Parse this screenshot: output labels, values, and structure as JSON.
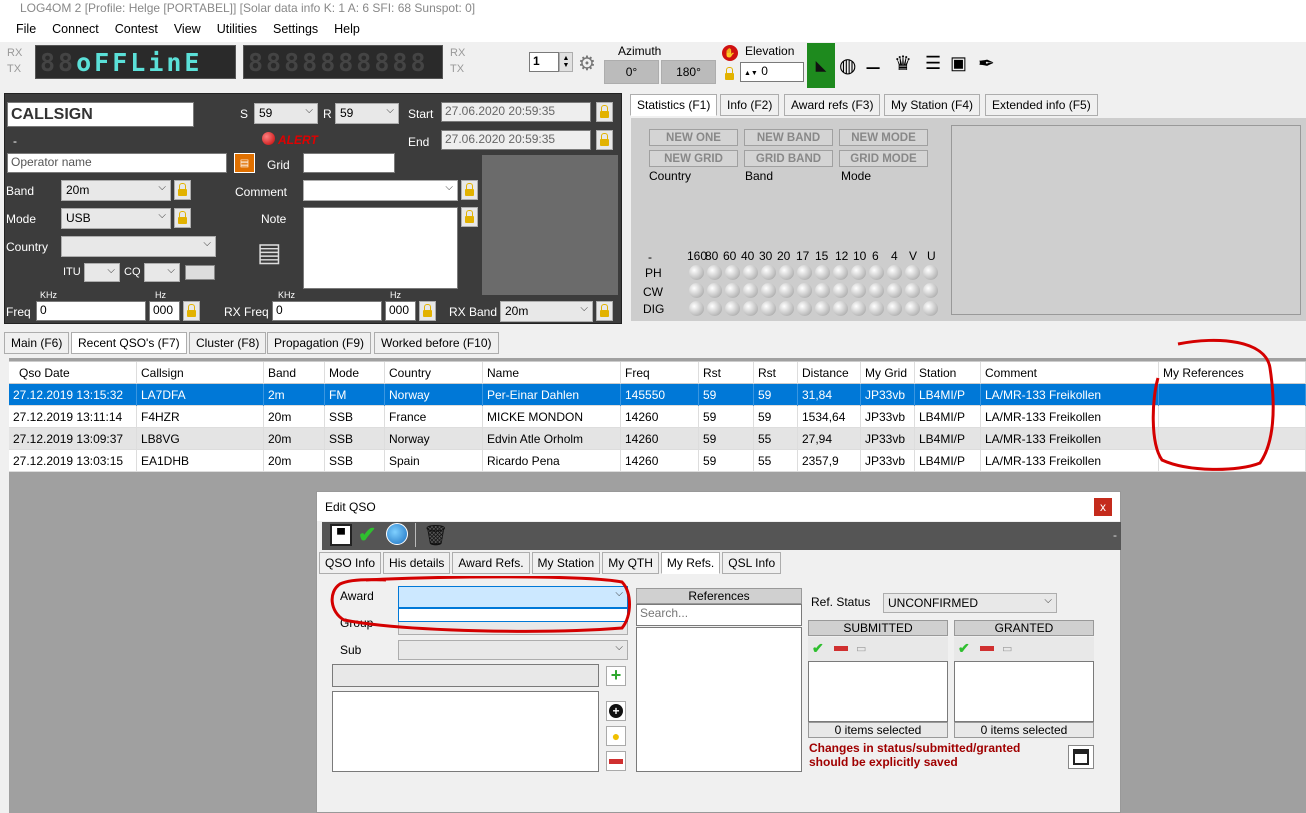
{
  "window": {
    "title": "LOG4OM 2 [Profile: Helge [PORTABEL]] [Solar data info K: 1 A: 6 SFI: 68 Sunspot: 0]"
  },
  "menu": [
    "File",
    "Connect",
    "Contest",
    "View",
    "Utilities",
    "Settings",
    "Help"
  ],
  "top": {
    "rx": "RX",
    "tx": "TX",
    "display_dim": "88",
    "display_on": "oFFLinE",
    "display_right": "8888888888",
    "step_value": "1",
    "azimuth_label": "Azimuth",
    "az0": "0°",
    "az180": "180°",
    "elevation_label": "Elevation",
    "elevation_value": "0"
  },
  "entry": {
    "callsign_placeholder": "CALLSIGN",
    "dash": "-",
    "operator_placeholder": "Operator name",
    "s_label": "S",
    "s_value": "59",
    "r_label": "R",
    "r_value": "59",
    "start_label": "Start",
    "start_value": "27.06.2020 20:59:35",
    "end_label": "End",
    "end_value": "27.06.2020 20:59:35",
    "alert": "ALERT",
    "grid_label": "Grid",
    "band_label": "Band",
    "band_value": "20m",
    "mode_label": "Mode",
    "mode_value": "USB",
    "country_label": "Country",
    "itu_label": "ITU",
    "cq_label": "CQ",
    "comment_label": "Comment",
    "note_label": "Note",
    "freq_label": "Freq",
    "khz": "KHz",
    "hz": "Hz",
    "freq_value": "0",
    "hz_value": "000",
    "rxfreq_label": "RX Freq",
    "rxfreq_value": "0",
    "rxhz_value": "000",
    "rxband_label": "RX Band",
    "rxband_value": "20m"
  },
  "right_tabs": [
    "Statistics (F1)",
    "Info (F2)",
    "Award refs (F3)",
    "My Station (F4)",
    "Extended info (F5)"
  ],
  "stats": {
    "buttons": [
      "NEW ONE",
      "NEW BAND",
      "NEW MODE",
      "NEW GRID",
      "GRID BAND",
      "GRID MODE"
    ],
    "labels": [
      "Country",
      "Band",
      "Mode"
    ],
    "dash": "-",
    "bands": [
      "160",
      "80",
      "60",
      "40",
      "30",
      "20",
      "17",
      "15",
      "12",
      "10",
      "6",
      "4",
      "V",
      "U"
    ],
    "modes": [
      "PH",
      "CW",
      "DIG"
    ]
  },
  "main_tabs": [
    "Main (F6)",
    "Recent QSO's (F7)",
    "Cluster (F8)",
    "Propagation (F9)",
    "Worked before (F10)"
  ],
  "grid": {
    "columns": [
      "Qso Date",
      "Callsign",
      "Band",
      "Mode",
      "Country",
      "Name",
      "Freq",
      "Rst",
      "Rst",
      "Distance",
      "My Grid",
      "Station",
      "Comment",
      "My References"
    ],
    "rows": [
      [
        "27.12.2019 13:15:32",
        "LA7DFA",
        "2m",
        "FM",
        "Norway",
        "Per-Einar Dahlen",
        "145550",
        "59",
        "59",
        "31,84",
        "JP33vb",
        "LB4MI/P",
        "LA/MR-133 Freikollen",
        ""
      ],
      [
        "27.12.2019 13:11:14",
        "F4HZR",
        "20m",
        "SSB",
        "France",
        "MICKE MONDON",
        "14260",
        "59",
        "59",
        "1534,64",
        "JP33vb",
        "LB4MI/P",
        "LA/MR-133 Freikollen",
        ""
      ],
      [
        "27.12.2019 13:09:37",
        "LB8VG",
        "20m",
        "SSB",
        "Norway",
        "Edvin Atle Orholm",
        "14260",
        "59",
        "55",
        "27,94",
        "JP33vb",
        "LB4MI/P",
        "LA/MR-133 Freikollen",
        ""
      ],
      [
        "27.12.2019 13:03:15",
        "EA1DHB",
        "20m",
        "SSB",
        "Spain",
        "Ricardo Pena",
        "14260",
        "59",
        "55",
        "2357,9",
        "JP33vb",
        "LB4MI/P",
        "LA/MR-133 Freikollen",
        ""
      ]
    ]
  },
  "dialog": {
    "title": "Edit QSO",
    "close": "x",
    "tool_dash": "-",
    "tabs": [
      "QSO Info",
      "His details",
      "Award Refs.",
      "My Station",
      "My QTH",
      "My Refs.",
      "QSL Info"
    ],
    "award_label": "Award",
    "group_label": "Group",
    "sub_label": "Sub",
    "references_header": "References",
    "search_placeholder": "Search...",
    "refstatus_label": "Ref. Status",
    "refstatus_value": "UNCONFIRMED",
    "submitted": "SUBMITTED",
    "granted": "GRANTED",
    "submitted_count": "0 items selected",
    "granted_count": "0 items selected",
    "warning1": "Changes in status/submitted/granted",
    "warning2": "should be explicitly saved"
  },
  "colors": {
    "selected_row": "#0078d7",
    "annotation": "#d40000",
    "alert": "#d00000"
  }
}
